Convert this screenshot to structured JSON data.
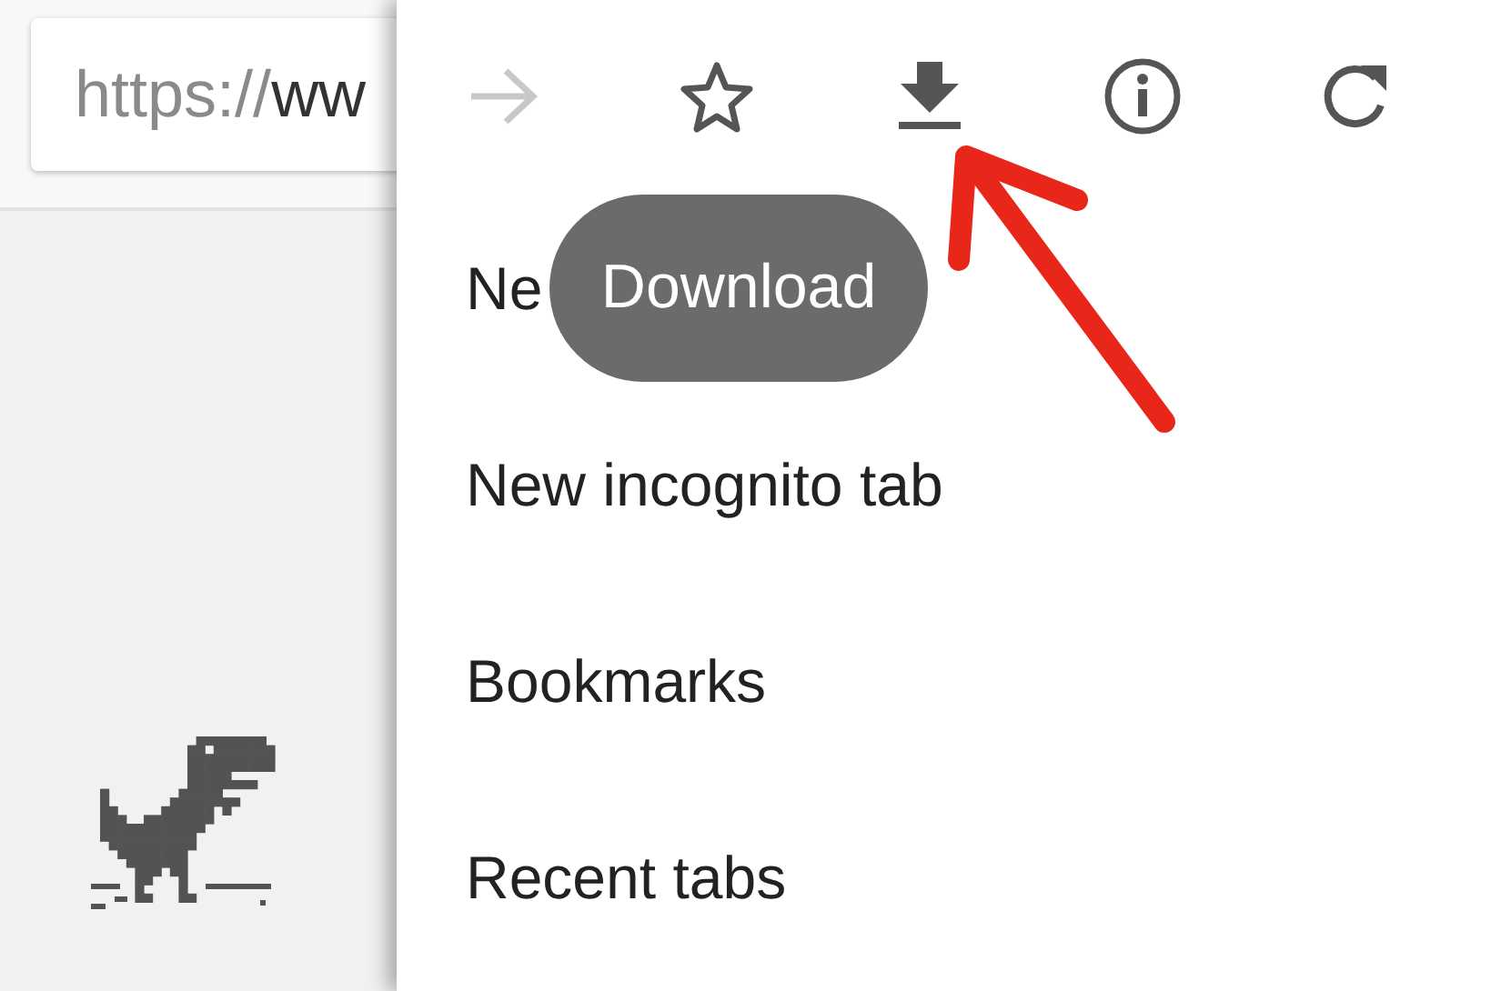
{
  "address_bar": {
    "scheme": "https://",
    "host": "ww"
  },
  "toolbar": [
    {
      "kind": "forward",
      "disabled": true
    },
    {
      "kind": "bookmark",
      "disabled": false
    },
    {
      "kind": "download",
      "disabled": false
    },
    {
      "kind": "info",
      "disabled": false
    },
    {
      "kind": "reload",
      "disabled": false
    }
  ],
  "tooltip": "Download",
  "menu_items": [
    "Ne",
    "New incognito tab",
    "Bookmarks",
    "Recent tabs"
  ]
}
